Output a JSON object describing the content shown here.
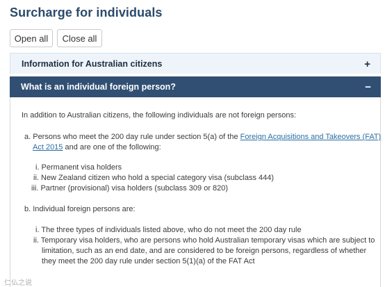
{
  "page": {
    "title": "Surcharge for individuals"
  },
  "toolbar": {
    "open_all": "Open all",
    "close_all": "Close all"
  },
  "accordion": {
    "items": [
      {
        "label": "Information for Australian citizens",
        "toggle": "+"
      },
      {
        "label": "What is an individual foreign person?",
        "toggle": "−"
      }
    ]
  },
  "content": {
    "intro": "In addition to Australian citizens, the following individuals are not foreign persons:",
    "a_line1_prefix": "a. Persons who meet the 200 day rule under section 5(a) of the ",
    "a_link_line1": "Foreign Acquisitions and Takeovers (FAT)",
    "a_link_line2": "Act 2015",
    "a_line2_suffix": " and are one of the following:",
    "a_items": [
      "i. Permanent visa holders",
      "ii. New Zealand citizen who hold a special category visa (subclass 444)",
      "iii. Partner (provisional) visa holders (subclass 309 or 820)"
    ],
    "b_heading": "b. Individual foreign persons are:",
    "b_items": [
      "i. The three types of individuals listed above, who do not meet the 200 day rule",
      "ii. Temporary visa holders, who are persons who hold Australian temporary visas which are subject to",
      "limitation, such as an end date, and are considered to be foreign persons, regardless of whether",
      "they meet the 200 day rule under section 5(1)(a) of the FAT Act"
    ]
  },
  "watermark": "仁仏之说"
}
